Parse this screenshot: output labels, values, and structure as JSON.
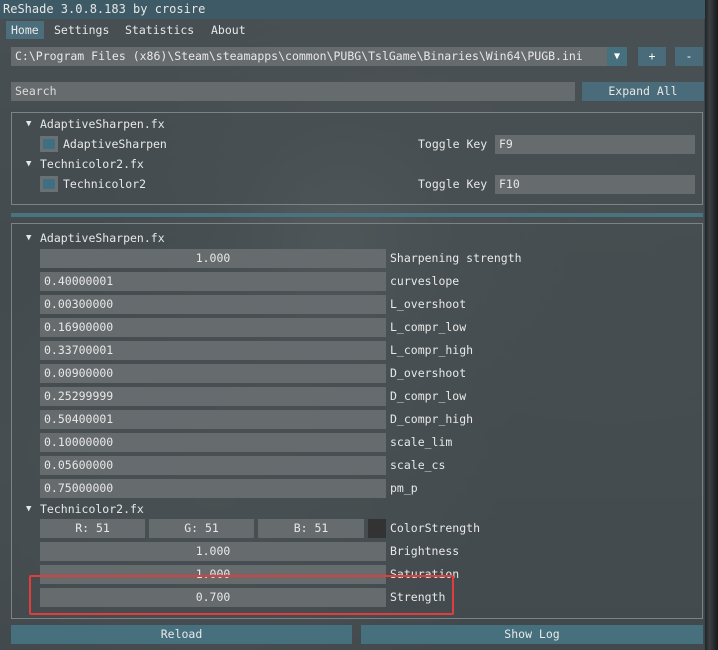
{
  "title": "ReShade 3.0.8.183 by crosire",
  "menu": [
    "Home",
    "Settings",
    "Statistics",
    "About"
  ],
  "active_menu": "Home",
  "preset_path": "C:\\Program Files (x86)\\Steam\\steamapps\\common\\PUBG\\TslGame\\Binaries\\Win64\\PUGB.ini",
  "dropdown_glyph": "▼",
  "add_label": "+",
  "remove_label": "-",
  "search_placeholder": "Search",
  "expand_all": "Expand All",
  "tree_arrow": "▼",
  "techniques": [
    {
      "file": "AdaptiveSharpen.fx",
      "name": "AdaptiveSharpen",
      "toggle_label": "Toggle Key",
      "key": "F9",
      "enabled": true
    },
    {
      "file": "Technicolor2.fx",
      "name": "Technicolor2",
      "toggle_label": "Toggle Key",
      "key": "F10",
      "enabled": true
    }
  ],
  "params_adaptive": {
    "file": "AdaptiveSharpen.fx",
    "rows": [
      {
        "value": "1.000",
        "label": "Sharpening strength"
      },
      {
        "value": "0.40000001",
        "label": "curveslope"
      },
      {
        "value": "0.00300000",
        "label": "L_overshoot"
      },
      {
        "value": "0.16900000",
        "label": "L_compr_low"
      },
      {
        "value": "0.33700001",
        "label": "L_compr_high"
      },
      {
        "value": "0.00900000",
        "label": "D_overshoot"
      },
      {
        "value": "0.25299999",
        "label": "D_compr_low"
      },
      {
        "value": "0.50400001",
        "label": "D_compr_high"
      },
      {
        "value": "0.10000000",
        "label": "scale_lim"
      },
      {
        "value": "0.05600000",
        "label": "scale_cs"
      },
      {
        "value": "0.75000000",
        "label": "pm_p"
      }
    ]
  },
  "params_technicolor": {
    "file": "Technicolor2.fx",
    "color": {
      "r": "R: 51",
      "g": "G: 51",
      "b": "B: 51",
      "label": "ColorStrength",
      "swatch": "#333333"
    },
    "rows": [
      {
        "value": "1.000",
        "label": "Brightness"
      },
      {
        "value": "1.000",
        "label": "Saturation"
      },
      {
        "value": "0.700",
        "label": "Strength"
      }
    ]
  },
  "reload": "Reload",
  "show_log": "Show Log",
  "colors": {
    "accent": "#4a6b79",
    "title_bar": "#3e5a66",
    "highlight": "#e23c3c"
  }
}
